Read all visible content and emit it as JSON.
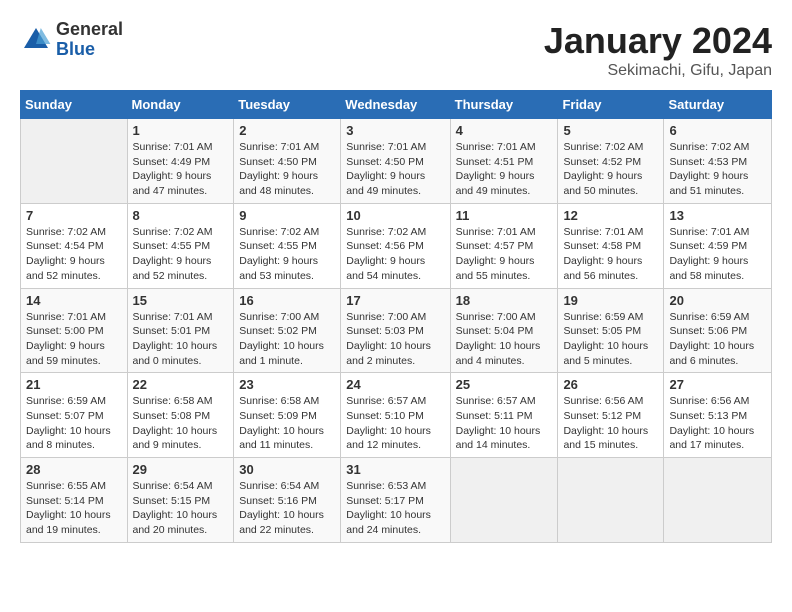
{
  "logo": {
    "general": "General",
    "blue": "Blue"
  },
  "title": "January 2024",
  "subtitle": "Sekimachi, Gifu, Japan",
  "headers": [
    "Sunday",
    "Monday",
    "Tuesday",
    "Wednesday",
    "Thursday",
    "Friday",
    "Saturday"
  ],
  "weeks": [
    [
      {
        "day": "",
        "info": ""
      },
      {
        "day": "1",
        "info": "Sunrise: 7:01 AM\nSunset: 4:49 PM\nDaylight: 9 hours\nand 47 minutes."
      },
      {
        "day": "2",
        "info": "Sunrise: 7:01 AM\nSunset: 4:50 PM\nDaylight: 9 hours\nand 48 minutes."
      },
      {
        "day": "3",
        "info": "Sunrise: 7:01 AM\nSunset: 4:50 PM\nDaylight: 9 hours\nand 49 minutes."
      },
      {
        "day": "4",
        "info": "Sunrise: 7:01 AM\nSunset: 4:51 PM\nDaylight: 9 hours\nand 49 minutes."
      },
      {
        "day": "5",
        "info": "Sunrise: 7:02 AM\nSunset: 4:52 PM\nDaylight: 9 hours\nand 50 minutes."
      },
      {
        "day": "6",
        "info": "Sunrise: 7:02 AM\nSunset: 4:53 PM\nDaylight: 9 hours\nand 51 minutes."
      }
    ],
    [
      {
        "day": "7",
        "info": "Sunrise: 7:02 AM\nSunset: 4:54 PM\nDaylight: 9 hours\nand 52 minutes."
      },
      {
        "day": "8",
        "info": "Sunrise: 7:02 AM\nSunset: 4:55 PM\nDaylight: 9 hours\nand 52 minutes."
      },
      {
        "day": "9",
        "info": "Sunrise: 7:02 AM\nSunset: 4:55 PM\nDaylight: 9 hours\nand 53 minutes."
      },
      {
        "day": "10",
        "info": "Sunrise: 7:02 AM\nSunset: 4:56 PM\nDaylight: 9 hours\nand 54 minutes."
      },
      {
        "day": "11",
        "info": "Sunrise: 7:01 AM\nSunset: 4:57 PM\nDaylight: 9 hours\nand 55 minutes."
      },
      {
        "day": "12",
        "info": "Sunrise: 7:01 AM\nSunset: 4:58 PM\nDaylight: 9 hours\nand 56 minutes."
      },
      {
        "day": "13",
        "info": "Sunrise: 7:01 AM\nSunset: 4:59 PM\nDaylight: 9 hours\nand 58 minutes."
      }
    ],
    [
      {
        "day": "14",
        "info": "Sunrise: 7:01 AM\nSunset: 5:00 PM\nDaylight: 9 hours\nand 59 minutes."
      },
      {
        "day": "15",
        "info": "Sunrise: 7:01 AM\nSunset: 5:01 PM\nDaylight: 10 hours\nand 0 minutes."
      },
      {
        "day": "16",
        "info": "Sunrise: 7:00 AM\nSunset: 5:02 PM\nDaylight: 10 hours\nand 1 minute."
      },
      {
        "day": "17",
        "info": "Sunrise: 7:00 AM\nSunset: 5:03 PM\nDaylight: 10 hours\nand 2 minutes."
      },
      {
        "day": "18",
        "info": "Sunrise: 7:00 AM\nSunset: 5:04 PM\nDaylight: 10 hours\nand 4 minutes."
      },
      {
        "day": "19",
        "info": "Sunrise: 6:59 AM\nSunset: 5:05 PM\nDaylight: 10 hours\nand 5 minutes."
      },
      {
        "day": "20",
        "info": "Sunrise: 6:59 AM\nSunset: 5:06 PM\nDaylight: 10 hours\nand 6 minutes."
      }
    ],
    [
      {
        "day": "21",
        "info": "Sunrise: 6:59 AM\nSunset: 5:07 PM\nDaylight: 10 hours\nand 8 minutes."
      },
      {
        "day": "22",
        "info": "Sunrise: 6:58 AM\nSunset: 5:08 PM\nDaylight: 10 hours\nand 9 minutes."
      },
      {
        "day": "23",
        "info": "Sunrise: 6:58 AM\nSunset: 5:09 PM\nDaylight: 10 hours\nand 11 minutes."
      },
      {
        "day": "24",
        "info": "Sunrise: 6:57 AM\nSunset: 5:10 PM\nDaylight: 10 hours\nand 12 minutes."
      },
      {
        "day": "25",
        "info": "Sunrise: 6:57 AM\nSunset: 5:11 PM\nDaylight: 10 hours\nand 14 minutes."
      },
      {
        "day": "26",
        "info": "Sunrise: 6:56 AM\nSunset: 5:12 PM\nDaylight: 10 hours\nand 15 minutes."
      },
      {
        "day": "27",
        "info": "Sunrise: 6:56 AM\nSunset: 5:13 PM\nDaylight: 10 hours\nand 17 minutes."
      }
    ],
    [
      {
        "day": "28",
        "info": "Sunrise: 6:55 AM\nSunset: 5:14 PM\nDaylight: 10 hours\nand 19 minutes."
      },
      {
        "day": "29",
        "info": "Sunrise: 6:54 AM\nSunset: 5:15 PM\nDaylight: 10 hours\nand 20 minutes."
      },
      {
        "day": "30",
        "info": "Sunrise: 6:54 AM\nSunset: 5:16 PM\nDaylight: 10 hours\nand 22 minutes."
      },
      {
        "day": "31",
        "info": "Sunrise: 6:53 AM\nSunset: 5:17 PM\nDaylight: 10 hours\nand 24 minutes."
      },
      {
        "day": "",
        "info": ""
      },
      {
        "day": "",
        "info": ""
      },
      {
        "day": "",
        "info": ""
      }
    ]
  ]
}
